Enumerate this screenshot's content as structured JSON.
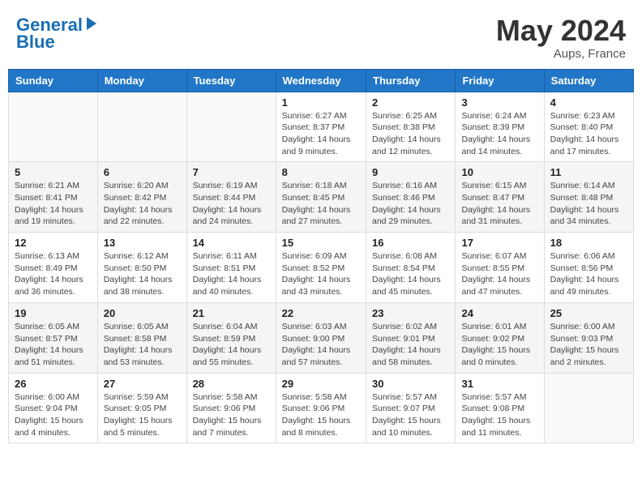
{
  "header": {
    "logo_line1": "General",
    "logo_line2": "Blue",
    "month": "May 2024",
    "location": "Aups, France"
  },
  "columns": [
    "Sunday",
    "Monday",
    "Tuesday",
    "Wednesday",
    "Thursday",
    "Friday",
    "Saturday"
  ],
  "weeks": [
    [
      {
        "day": "",
        "info": ""
      },
      {
        "day": "",
        "info": ""
      },
      {
        "day": "",
        "info": ""
      },
      {
        "day": "1",
        "info": "Sunrise: 6:27 AM\nSunset: 8:37 PM\nDaylight: 14 hours\nand 9 minutes."
      },
      {
        "day": "2",
        "info": "Sunrise: 6:25 AM\nSunset: 8:38 PM\nDaylight: 14 hours\nand 12 minutes."
      },
      {
        "day": "3",
        "info": "Sunrise: 6:24 AM\nSunset: 8:39 PM\nDaylight: 14 hours\nand 14 minutes."
      },
      {
        "day": "4",
        "info": "Sunrise: 6:23 AM\nSunset: 8:40 PM\nDaylight: 14 hours\nand 17 minutes."
      }
    ],
    [
      {
        "day": "5",
        "info": "Sunrise: 6:21 AM\nSunset: 8:41 PM\nDaylight: 14 hours\nand 19 minutes."
      },
      {
        "day": "6",
        "info": "Sunrise: 6:20 AM\nSunset: 8:42 PM\nDaylight: 14 hours\nand 22 minutes."
      },
      {
        "day": "7",
        "info": "Sunrise: 6:19 AM\nSunset: 8:44 PM\nDaylight: 14 hours\nand 24 minutes."
      },
      {
        "day": "8",
        "info": "Sunrise: 6:18 AM\nSunset: 8:45 PM\nDaylight: 14 hours\nand 27 minutes."
      },
      {
        "day": "9",
        "info": "Sunrise: 6:16 AM\nSunset: 8:46 PM\nDaylight: 14 hours\nand 29 minutes."
      },
      {
        "day": "10",
        "info": "Sunrise: 6:15 AM\nSunset: 8:47 PM\nDaylight: 14 hours\nand 31 minutes."
      },
      {
        "day": "11",
        "info": "Sunrise: 6:14 AM\nSunset: 8:48 PM\nDaylight: 14 hours\nand 34 minutes."
      }
    ],
    [
      {
        "day": "12",
        "info": "Sunrise: 6:13 AM\nSunset: 8:49 PM\nDaylight: 14 hours\nand 36 minutes."
      },
      {
        "day": "13",
        "info": "Sunrise: 6:12 AM\nSunset: 8:50 PM\nDaylight: 14 hours\nand 38 minutes."
      },
      {
        "day": "14",
        "info": "Sunrise: 6:11 AM\nSunset: 8:51 PM\nDaylight: 14 hours\nand 40 minutes."
      },
      {
        "day": "15",
        "info": "Sunrise: 6:09 AM\nSunset: 8:52 PM\nDaylight: 14 hours\nand 43 minutes."
      },
      {
        "day": "16",
        "info": "Sunrise: 6:08 AM\nSunset: 8:54 PM\nDaylight: 14 hours\nand 45 minutes."
      },
      {
        "day": "17",
        "info": "Sunrise: 6:07 AM\nSunset: 8:55 PM\nDaylight: 14 hours\nand 47 minutes."
      },
      {
        "day": "18",
        "info": "Sunrise: 6:06 AM\nSunset: 8:56 PM\nDaylight: 14 hours\nand 49 minutes."
      }
    ],
    [
      {
        "day": "19",
        "info": "Sunrise: 6:05 AM\nSunset: 8:57 PM\nDaylight: 14 hours\nand 51 minutes."
      },
      {
        "day": "20",
        "info": "Sunrise: 6:05 AM\nSunset: 8:58 PM\nDaylight: 14 hours\nand 53 minutes."
      },
      {
        "day": "21",
        "info": "Sunrise: 6:04 AM\nSunset: 8:59 PM\nDaylight: 14 hours\nand 55 minutes."
      },
      {
        "day": "22",
        "info": "Sunrise: 6:03 AM\nSunset: 9:00 PM\nDaylight: 14 hours\nand 57 minutes."
      },
      {
        "day": "23",
        "info": "Sunrise: 6:02 AM\nSunset: 9:01 PM\nDaylight: 14 hours\nand 58 minutes."
      },
      {
        "day": "24",
        "info": "Sunrise: 6:01 AM\nSunset: 9:02 PM\nDaylight: 15 hours\nand 0 minutes."
      },
      {
        "day": "25",
        "info": "Sunrise: 6:00 AM\nSunset: 9:03 PM\nDaylight: 15 hours\nand 2 minutes."
      }
    ],
    [
      {
        "day": "26",
        "info": "Sunrise: 6:00 AM\nSunset: 9:04 PM\nDaylight: 15 hours\nand 4 minutes."
      },
      {
        "day": "27",
        "info": "Sunrise: 5:59 AM\nSunset: 9:05 PM\nDaylight: 15 hours\nand 5 minutes."
      },
      {
        "day": "28",
        "info": "Sunrise: 5:58 AM\nSunset: 9:06 PM\nDaylight: 15 hours\nand 7 minutes."
      },
      {
        "day": "29",
        "info": "Sunrise: 5:58 AM\nSunset: 9:06 PM\nDaylight: 15 hours\nand 8 minutes."
      },
      {
        "day": "30",
        "info": "Sunrise: 5:57 AM\nSunset: 9:07 PM\nDaylight: 15 hours\nand 10 minutes."
      },
      {
        "day": "31",
        "info": "Sunrise: 5:57 AM\nSunset: 9:08 PM\nDaylight: 15 hours\nand 11 minutes."
      },
      {
        "day": "",
        "info": ""
      }
    ]
  ]
}
